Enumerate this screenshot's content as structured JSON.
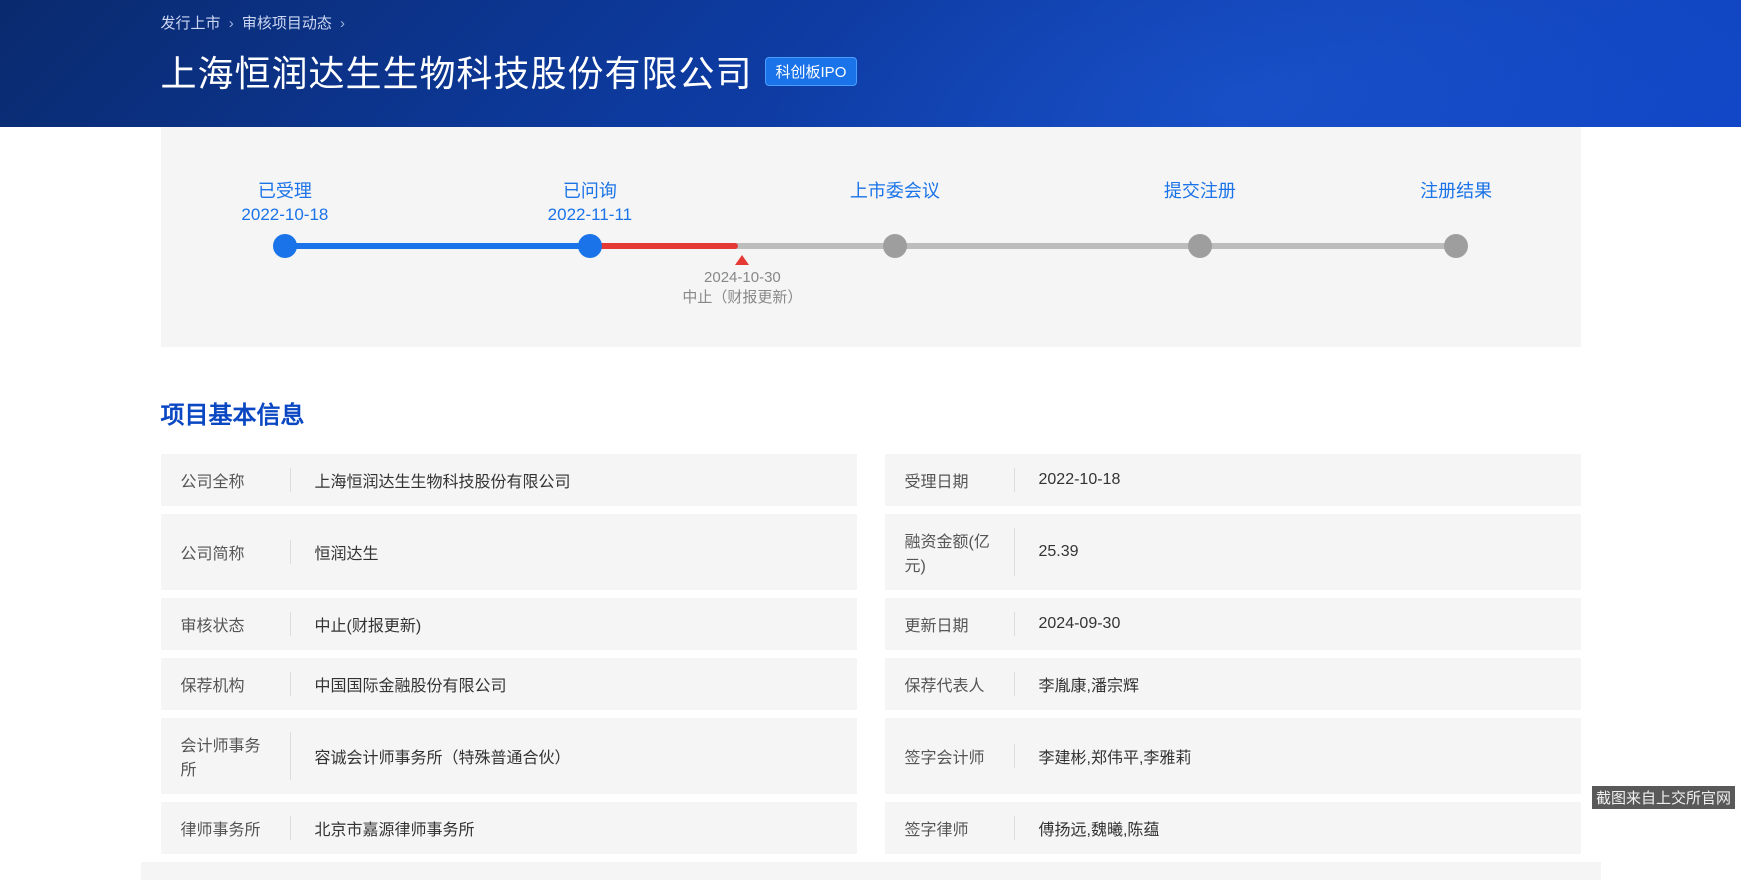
{
  "breadcrumb": {
    "item1": "发行上市",
    "item2": "审核项目动态"
  },
  "title": "上海恒润达生生物科技股份有限公司",
  "badge": "科创板IPO",
  "timeline": {
    "steps": [
      {
        "label": "已受理",
        "date": "2022-10-18"
      },
      {
        "label": "已问询",
        "date": "2022-11-11"
      },
      {
        "label": "上市委会议",
        "date": ""
      },
      {
        "label": "提交注册",
        "date": ""
      },
      {
        "label": "注册结果",
        "date": ""
      }
    ],
    "marker": {
      "date": "2024-10-30",
      "status": "中止（财报更新）"
    }
  },
  "section_title": "项目基本信息",
  "info": {
    "left": [
      {
        "label": "公司全称",
        "value": "上海恒润达生生物科技股份有限公司"
      },
      {
        "label": "公司简称",
        "value": "恒润达生"
      },
      {
        "label": "审核状态",
        "value": "中止(财报更新)"
      },
      {
        "label": "保荐机构",
        "value": "中国国际金融股份有限公司"
      },
      {
        "label": "会计师事务所",
        "value": "容诚会计师事务所（特殊普通合伙）"
      },
      {
        "label": "律师事务所",
        "value": "北京市嘉源律师事务所"
      }
    ],
    "right": [
      {
        "label": "受理日期",
        "value": "2022-10-18"
      },
      {
        "label": "融资金额(亿元)",
        "value": "25.39"
      },
      {
        "label": "更新日期",
        "value": "2024-09-30"
      },
      {
        "label": "保荐代表人",
        "value": "李胤康,潘宗辉"
      },
      {
        "label": "签字会计师",
        "value": "李建彬,郑伟平,李雅莉"
      },
      {
        "label": "签字律师",
        "value": "傅扬远,魏曦,陈蕴"
      }
    ]
  },
  "footer": "截图来自上交所官网"
}
